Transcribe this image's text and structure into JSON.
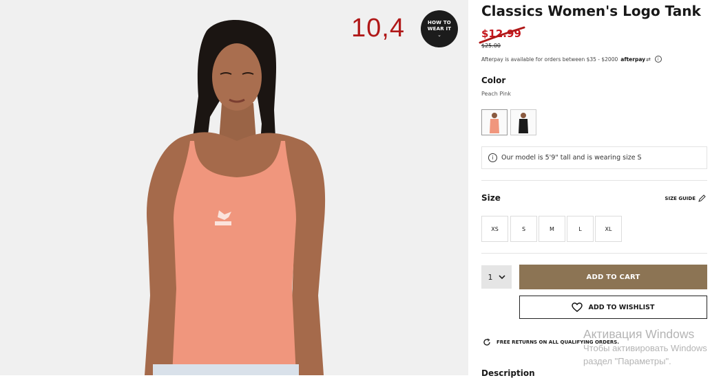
{
  "product": {
    "title": "Classics Women's Logo Tank",
    "sale_price": "$12.99",
    "original_price": "$25.00",
    "afterpay_text": "Afterpay is available for orders between $35 - $2000",
    "afterpay_brand": "afterpay",
    "afterpay_info": "i"
  },
  "overlay": {
    "price_note": "10,4",
    "how_to_wear_line1": "HOW TO",
    "how_to_wear_line2": "WEAR IT",
    "chevron": "⌄"
  },
  "color": {
    "label": "Color",
    "value": "Peach Pink",
    "swatches": [
      {
        "name": "peach pink",
        "color": "#f0967d",
        "selected": true
      },
      {
        "name": "black",
        "color": "#1a1a1a",
        "selected": false
      }
    ]
  },
  "model_info": {
    "icon": "i",
    "text": "Our model is 5'9\" tall and is wearing size S"
  },
  "size": {
    "label": "Size",
    "guide": "SIZE GUIDE",
    "options": [
      "XS",
      "S",
      "M",
      "L",
      "XL"
    ]
  },
  "cart": {
    "quantity": "1",
    "add_to_cart": "ADD TO CART",
    "add_to_wishlist": "ADD TO WISHLIST"
  },
  "returns": "FREE RETURNS ON ALL QUALIFYING ORDERS.",
  "description_heading": "Description",
  "watermark": {
    "line1": "Активация Windows",
    "line2": "Чтобы активировать Windows",
    "line3": "раздел \"Параметры\"."
  },
  "colors": {
    "accent": "#8c7454",
    "sale": "#c4161c",
    "overlay_text": "#b01818",
    "tank": "#f0967d"
  }
}
